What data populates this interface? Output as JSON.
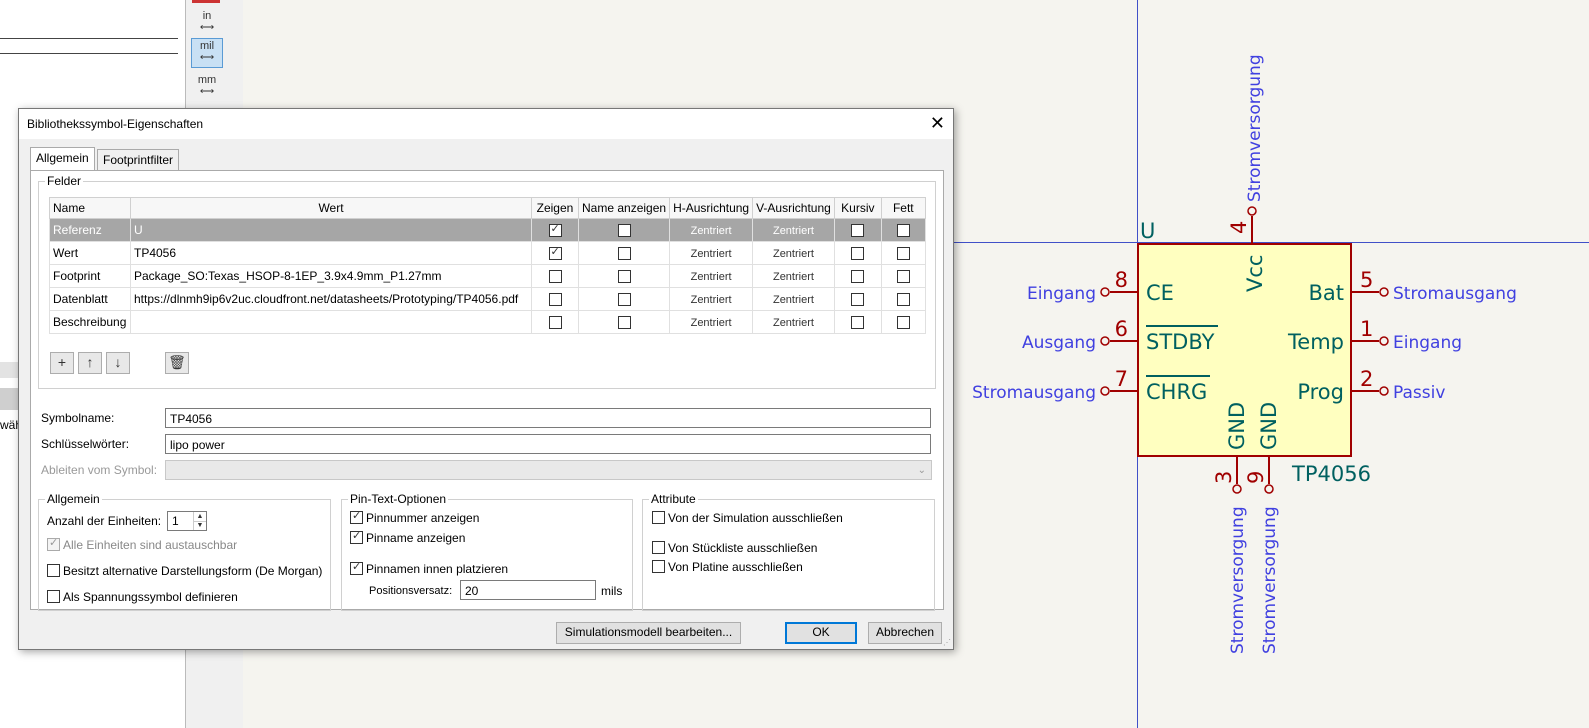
{
  "background": {
    "left_panel_stub": "wäh",
    "units_toolbar": [
      {
        "label": "in",
        "active": false
      },
      {
        "label": "mil",
        "active": true
      },
      {
        "label": "mm",
        "active": false
      }
    ]
  },
  "schematic": {
    "reference": "U",
    "value": "TP4056",
    "colors": {
      "pin_number": "#a00000",
      "pin_name": "#006060",
      "pin_type": "#4040e0",
      "body_fill": "#ffffc0",
      "body_stroke": "#a00000",
      "axis": "#4050c8"
    },
    "pins": {
      "top": {
        "number": "4",
        "name": "Vcc",
        "type": "Stromversorgung"
      },
      "left": [
        {
          "number": "8",
          "name": "CE",
          "type": "Eingang"
        },
        {
          "number": "6",
          "name": "STDBY",
          "type": "Ausgang"
        },
        {
          "number": "7",
          "name": "CHRG",
          "type": "Stromausgang"
        }
      ],
      "right": [
        {
          "number": "5",
          "name": "Bat",
          "type": "Stromausgang"
        },
        {
          "number": "1",
          "name": "Temp",
          "type": "Eingang"
        },
        {
          "number": "2",
          "name": "Prog",
          "type": "Passiv"
        }
      ],
      "bottom": [
        {
          "number": "3",
          "name": "GND",
          "type": "Stromversorgung"
        },
        {
          "number": "9",
          "name": "GND",
          "type": "Stromversorgung"
        }
      ]
    }
  },
  "dialog": {
    "title": "Bibliothekssymbol-Eigenschaften",
    "tabs": [
      "Allgemein",
      "Footprintfilter"
    ],
    "felder_label": "Felder",
    "columns": [
      "Name",
      "Wert",
      "Zeigen",
      "Name anzeigen",
      "H-Ausrichtung",
      "V-Ausrichtung",
      "Kursiv",
      "Fett"
    ],
    "rows": [
      {
        "name": "Referenz",
        "value": "U",
        "show": true,
        "show_name": false,
        "h": "Zentriert",
        "v": "Zentriert",
        "italic": false,
        "bold": false,
        "selected": true
      },
      {
        "name": "Wert",
        "value": "TP4056",
        "show": true,
        "show_name": false,
        "h": "Zentriert",
        "v": "Zentriert",
        "italic": false,
        "bold": false,
        "selected": false
      },
      {
        "name": "Footprint",
        "value": "Package_SO:Texas_HSOP-8-1EP_3.9x4.9mm_P1.27mm",
        "show": false,
        "show_name": false,
        "h": "Zentriert",
        "v": "Zentriert",
        "italic": false,
        "bold": false,
        "selected": false
      },
      {
        "name": "Datenblatt",
        "value": "https://dlnmh9ip6v2uc.cloudfront.net/datasheets/Prototyping/TP4056.pdf",
        "show": false,
        "show_name": false,
        "h": "Zentriert",
        "v": "Zentriert",
        "italic": false,
        "bold": false,
        "selected": false
      },
      {
        "name": "Beschreibung",
        "value": "",
        "show": false,
        "show_name": false,
        "h": "Zentriert",
        "v": "Zentriert",
        "italic": false,
        "bold": false,
        "selected": false
      }
    ],
    "symbolname_label": "Symbolname:",
    "symbolname_value": "TP4056",
    "keywords_label": "Schlüsselwörter:",
    "keywords_value": "lipo power",
    "derive_label": "Ableiten vom Symbol:",
    "derive_value": "",
    "allgemein": {
      "label": "Allgemein",
      "units_label": "Anzahl der Einheiten:",
      "units_value": "1",
      "interchangeable": "Alle Einheiten sind austauschbar",
      "demorgan": "Besitzt alternative Darstellungsform (De Morgan)",
      "power": "Als Spannungssymbol definieren"
    },
    "pintext": {
      "label": "Pin-Text-Optionen",
      "show_numbers": "Pinnummer anzeigen",
      "show_names": "Pinname anzeigen",
      "inside": "Pinnamen innen platzieren",
      "offset_label": "Positionsversatz:",
      "offset_value": "20",
      "offset_unit": "mils"
    },
    "attribute": {
      "label": "Attribute",
      "exclude_sim": "Von der Simulation ausschließen",
      "exclude_bom": "Von Stückliste ausschließen",
      "exclude_board": "Von Platine ausschließen"
    },
    "buttons": {
      "sim_model": "Simulationsmodell bearbeiten...",
      "ok": "OK",
      "cancel": "Abbrechen"
    }
  }
}
